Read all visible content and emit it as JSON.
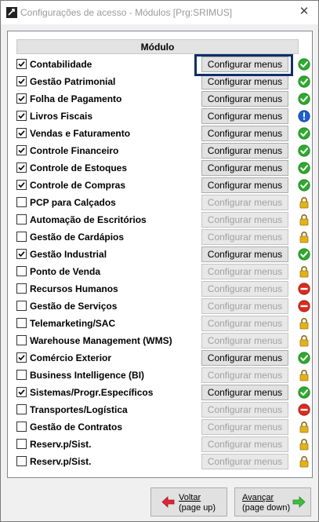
{
  "window": {
    "title": "Configurações de acesso - Módulos [Prg:SRIMUS]",
    "close_glyph": "✕"
  },
  "table": {
    "header": "Módulo"
  },
  "rows": [
    {
      "label": "Contabilidade",
      "checked": true,
      "button": "Configurar menus",
      "enabled": true,
      "status": "ok-icon"
    },
    {
      "label": "Gestão Patrimonial",
      "checked": true,
      "button": "Configurar menus",
      "enabled": true,
      "status": "ok-icon"
    },
    {
      "label": "Folha de Pagamento",
      "checked": true,
      "button": "Configurar menus",
      "enabled": true,
      "status": "ok-icon"
    },
    {
      "label": "Livros Fiscais",
      "checked": true,
      "button": "Configurar menus",
      "enabled": true,
      "status": "info-icon"
    },
    {
      "label": "Vendas e Faturamento",
      "checked": true,
      "button": "Configurar menus",
      "enabled": true,
      "status": "ok-icon"
    },
    {
      "label": "Controle Financeiro",
      "checked": true,
      "button": "Configurar menus",
      "enabled": true,
      "status": "ok-icon"
    },
    {
      "label": "Controle de Estoques",
      "checked": true,
      "button": "Configurar menus",
      "enabled": true,
      "status": "ok-icon"
    },
    {
      "label": "Controle de Compras",
      "checked": true,
      "button": "Configurar menus",
      "enabled": true,
      "status": "ok-icon"
    },
    {
      "label": "PCP para Calçados",
      "checked": false,
      "button": "Configurar menus",
      "enabled": false,
      "status": "lock-icon"
    },
    {
      "label": "Automação de Escritórios",
      "checked": false,
      "button": "Configurar menus",
      "enabled": false,
      "status": "lock-icon"
    },
    {
      "label": "Gestão de Cardápios",
      "checked": false,
      "button": "Configurar menus",
      "enabled": false,
      "status": "lock-icon"
    },
    {
      "label": "Gestão Industrial",
      "checked": true,
      "button": "Configurar menus",
      "enabled": true,
      "status": "ok-icon"
    },
    {
      "label": "Ponto de Venda",
      "checked": false,
      "button": "Configurar menus",
      "enabled": false,
      "status": "lock-icon"
    },
    {
      "label": "Recursos Humanos",
      "checked": false,
      "button": "Configurar menus",
      "enabled": false,
      "status": "blocked-icon"
    },
    {
      "label": "Gestão de Serviços",
      "checked": false,
      "button": "Configurar menus",
      "enabled": false,
      "status": "blocked-icon"
    },
    {
      "label": "Telemarketing/SAC",
      "checked": false,
      "button": "Configurar menus",
      "enabled": false,
      "status": "lock-icon"
    },
    {
      "label": "Warehouse Management (WMS)",
      "checked": false,
      "button": "Configurar menus",
      "enabled": false,
      "status": "lock-icon"
    },
    {
      "label": "Comércio Exterior",
      "checked": true,
      "button": "Configurar menus",
      "enabled": true,
      "status": "ok-icon"
    },
    {
      "label": "Business Intelligence (BI)",
      "checked": false,
      "button": "Configurar menus",
      "enabled": false,
      "status": "lock-icon"
    },
    {
      "label": "Sistemas/Progr.Específicos",
      "checked": true,
      "button": "Configurar menus",
      "enabled": true,
      "status": "ok-icon"
    },
    {
      "label": "Transportes/Logística",
      "checked": false,
      "button": "Configurar menus",
      "enabled": false,
      "status": "blocked-icon"
    },
    {
      "label": "Gestão de Contratos",
      "checked": false,
      "button": "Configurar menus",
      "enabled": false,
      "status": "lock-icon"
    },
    {
      "label": "Reserv.p/Sist.",
      "checked": false,
      "button": "Configurar menus",
      "enabled": false,
      "status": "lock-icon"
    },
    {
      "label": "Reserv.p/Sist.",
      "checked": false,
      "button": "Configurar menus",
      "enabled": false,
      "status": "lock-icon"
    }
  ],
  "footer": {
    "back": {
      "line1": "Voltar",
      "line2": "(page up)",
      "icon": "arrow-left-icon"
    },
    "next": {
      "line1": "Avançar",
      "line2": "(page down)",
      "icon": "arrow-right-icon"
    }
  },
  "colors": {
    "ok": "#2eaa2e",
    "info": "#1e5fd0",
    "blocked": "#d92c1e",
    "lock": "#e3b21b",
    "focus": "#0f2f6b",
    "arrow_left": "#e0243a",
    "arrow_right": "#3fbf3f"
  }
}
